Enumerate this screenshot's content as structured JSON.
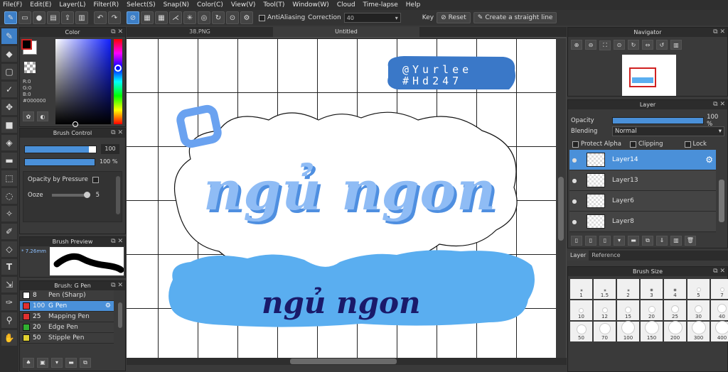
{
  "menu": [
    "File(F)",
    "Edit(E)",
    "Layer(L)",
    "Filter(R)",
    "Select(S)",
    "Snap(N)",
    "Color(C)",
    "View(V)",
    "Tool(T)",
    "Window(W)",
    "Cloud",
    "Time-lapse",
    "Help"
  ],
  "toolbar": {
    "antialiasing": "AntiAliasing",
    "correction_label": "Correction",
    "correction_value": "40",
    "key_label": "Key",
    "reset_label": "Reset",
    "straight_line_label": "Create a straight line"
  },
  "color_panel": {
    "title": "Color",
    "r": "R:0",
    "g": "G:0",
    "b": "B:0",
    "hex": "#000000",
    "fg": "#000000",
    "bg": "#ffffff"
  },
  "brush_control": {
    "title": "Brush Control",
    "size": "100",
    "opacity": "100 %",
    "opacity_by_pressure": "Opacity by Pressure",
    "ooze_label": "Ooze",
    "ooze_value": "5"
  },
  "brush_preview": {
    "title": "Brush Preview",
    "size": "7.26mm"
  },
  "brush_list": {
    "title": "Brush: G Pen",
    "items": [
      {
        "size": "8",
        "name": "Pen (Sharp)",
        "color": "#ffffff"
      },
      {
        "size": "100",
        "name": "G Pen",
        "color": "#e03030"
      },
      {
        "size": "25",
        "name": "Mapping Pen",
        "color": "#e03030"
      },
      {
        "size": "20",
        "name": "Edge Pen",
        "color": "#30b030"
      },
      {
        "size": "50",
        "name": "Stipple Pen",
        "color": "#e0d030"
      }
    ]
  },
  "tabs": [
    "38.PNG",
    "Untitled"
  ],
  "artwork": {
    "credit_line1": "@Yurlee",
    "credit_line2": "#Hd247",
    "main_text": "ngủ ngon",
    "sub_text": "ngủ ngon"
  },
  "navigator": {
    "title": "Navigator"
  },
  "layer_panel": {
    "title": "Layer",
    "opacity_label": "Opacity",
    "opacity_value": "100 %",
    "blending_label": "Blending",
    "blending_value": "Normal",
    "protect_alpha": "Protect Alpha",
    "clipping": "Clipping",
    "lock": "Lock",
    "layers": [
      {
        "name": "Layer14"
      },
      {
        "name": "Layer13"
      },
      {
        "name": "Layer6"
      },
      {
        "name": "Layer8"
      }
    ]
  },
  "side_tabs": [
    "Layer",
    "Reference"
  ],
  "brush_size": {
    "title": "Brush Size",
    "sizes": [
      "1",
      "1.5",
      "2",
      "3",
      "4",
      "5",
      "7",
      "10",
      "12",
      "15",
      "20",
      "25",
      "30",
      "40",
      "50",
      "70",
      "100",
      "150",
      "200",
      "300",
      "400"
    ]
  },
  "colors": {
    "accent": "#4a90d9",
    "cloud_blue": "#5aaef0",
    "text_blue": "#8fbcf5",
    "badge_blue": "#3a78c8"
  }
}
